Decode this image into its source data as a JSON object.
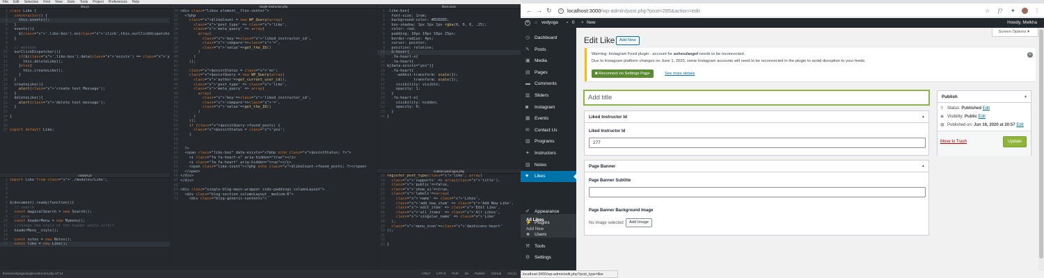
{
  "editor": {
    "menu": [
      "File",
      "Edit",
      "Selection",
      "Find",
      "View",
      "Goto",
      "Tools",
      "Project",
      "Preferences",
      "Help"
    ],
    "panes": {
      "likejs": {
        "title": "like.js",
        "lines": [
          "class Like {",
          "  constructor() {",
          "    this.events();",
          "  }",
          "  events(){",
          "    $('.like-box').on('click',this.ourClickDispatcher.bind(this));",
          "  }",
          "",
          "  // methods",
          "  ourClickDispatcher(){",
          "    if($('.like-box').data('exists') == 'yes'){",
          "      this.deleteLike();",
          "    }else{",
          "      this.createLike();",
          "    }",
          "  }",
          "  createLike(){",
          "    alert('create test Message');",
          "  }",
          "  deleteLike(){",
          "    alert('delete test message');",
          "  }",
          "",
          "}",
          "",
          "",
          "export default Like;"
        ]
      },
      "customjs": {
        "title": "custom.js",
        "lines": [
          "import Like from './modules/Like';",
          "",
          "",
          "",
          "",
          "$(document).ready(function(){",
          "  // search",
          "  const magicalSearch = new Search();",
          "  // menu",
          "  const headerMenu = new Mymenu();",
          "  //change the style of the header while scroll",
          "  headerMenu__style();",
          "",
          "  const notes = new Notes();",
          "  const like = new Like();"
        ]
      },
      "php": {
        "title": "single-instructor.php",
        "start": 30,
        "lines": [
          "<div class=\"likes element__flex-center\">",
          "  <?php",
          "    $likeCount = new WP_Query(array(",
          "      'post_type' => 'like',",
          "      'meta_query' => array(",
          "        array(",
          "          'key'=>'liked_instructor_id',",
          "          'compare'=>'=',",
          "          'value'=>get_the_ID()",
          "        )",
          "      )",
          "    ));",
          "",
          "    $existStatus = 'no';",
          "    $existQuery = new WP_Query(array(",
          "      'author'=>get_current_user_id(),",
          "      'post_type' => 'like',",
          "      'meta_query' => array(",
          "        array(",
          "          'key'=>'liked_instructor_id',",
          "          'compare'=>'=',",
          "          'value'=>get_the_ID()",
          "        )",
          "      )",
          "    ));",
          "    if ($existQuery->found_posts) {",
          "      $existStatus = 'yes';",
          "    }",
          "",
          "",
          "  ?>",
          "  <span class=\"like-box\" data-exists=\"<?php echo $existStatus; ?>\">",
          "    <i class=\"fa fa-heart-o\" aria-hidden=\"true\"></i>",
          "    <i class=\"fa fa-heart\" aria-hidden=\"true\"></i>",
          "    <span class=\"like-count\"><?php echo $likeCount->found_posts; ?></span>",
          "  </span>",
          "</div>",
          "</div>",
          "",
          "<div class=\"single-blog-main-wrapper side-paddings columnLayout\">",
          "  <div class=\"blog-section columnLayout__medium-8\">",
          "    <div class=\"blog-generic-contents\">"
        ]
      },
      "scss": {
        "title": "likes.scss",
        "start": 1,
        "lines": [
          ".like-box{",
          "  font-size: 1rem;",
          "  background-color: #EDEDED;",
          "  box-shadow: 1px 1px 1px rgba(0, 0, 0, .25);",
          "  color: red;",
          "  padding: 10px 10px 10px 25px;",
          "  border-radius: 4px;",
          "  cursor: pointer;",
          "  position: relative;",
          "  &:hover{",
          "  .fa-heart-o{",
          "  .fa-heart{",
          "&[data-exists=\"yes\"]{",
          "  .fa-heart{",
          "    -webkit-transform: scale(1);",
          "            transform: scale(1);",
          "    visibility: visible;",
          "    opacity: 1;",
          "  }",
          "  .fa-heart-o{",
          "    visibility: hidden;",
          "    opacity: 0;",
          "  }",
          "}"
        ]
      },
      "cpt": {
        "title": "custom-post-type.php",
        "start": 18,
        "lines": [
          "register_post_type('like', array(",
          "  'supports' => array('title'),",
          "  'public'=>false,",
          "  'show_ui'=>true,",
          "  'labels'=>array(",
          "    'name' => 'Likes',",
          "    'add_new_item' => 'Add New Like',",
          "    'edit_item' => 'Edit Like',",
          "    'all_items' => 'All Likes',",
          "    'singular_name' => 'Like'",
          "  ),",
          "  'menu_icon'=>'dashicons-heart'",
          "));",
          "",
          "",
          "}"
        ]
      }
    },
    "status_left": "theme/vedyoga/single-instructor.php   47:14",
    "status_right": [
      "CRLF",
      "UTF-8",
      "PHP",
      "29",
      "Publish",
      "GitHub",
      "Git (1)"
    ]
  },
  "browser": {
    "url_host": "localhost:3000",
    "url_path": "/wp-admin/post.php?post=285&action=edit",
    "status_url": "localhost:3000/wp-admin/edit.php?post_type=like"
  },
  "wp": {
    "site_name": "vedyoga",
    "comment_count": "0",
    "new_label": "New",
    "howdy": "Howdy, Metkha",
    "screen_options": "Screen Options",
    "menu": [
      {
        "label": "Dashboard",
        "icon": "dashboard"
      },
      {
        "label": "Posts",
        "icon": "pin"
      },
      {
        "label": "Media",
        "icon": "media"
      },
      {
        "label": "Pages",
        "icon": "page"
      },
      {
        "label": "Comments",
        "icon": "comment"
      },
      {
        "label": "Sliders",
        "icon": "slider"
      },
      {
        "label": "Instagram",
        "icon": "instagram"
      },
      {
        "label": "Events",
        "icon": "calendar"
      },
      {
        "label": "Contact Us",
        "icon": "contact"
      },
      {
        "label": "Programs",
        "icon": "program"
      },
      {
        "label": "Instructors",
        "icon": "instructor"
      },
      {
        "label": "Notes",
        "icon": "note"
      },
      {
        "label": "Likes",
        "icon": "heart"
      },
      {
        "label": "Appearance",
        "icon": "brush"
      },
      {
        "label": "Plugins",
        "icon": "plugin"
      },
      {
        "label": "Users",
        "icon": "user"
      },
      {
        "label": "Tools",
        "icon": "wrench"
      },
      {
        "label": "Settings",
        "icon": "settings"
      }
    ],
    "submenu": [
      "All Likes",
      "Add New"
    ],
    "page_title": "Edit Like",
    "add_new": "Add New",
    "notice": {
      "line1_prefix": "Warning: Instagram Feed plugin - account for ",
      "account": "ashesdangol",
      "line1_suffix": " needs to be reconnected.",
      "line2": "Due to Instagram platform changes on June 1, 2020, some Instagram accounts will need to be reconnected in the plugin to avoid disruption to your feeds.",
      "button": "Reconnect on Settings Page",
      "link": "See more details"
    },
    "title_placeholder": "Add title",
    "liked": {
      "header": "Liked Instructor Id",
      "label": "Liked Instructor Id",
      "value": "277"
    },
    "banner": {
      "header": "Page Banner",
      "subtitle_label": "Page Banner Subtitle",
      "bg_label": "Page Banner Background Image",
      "no_image": "No image selected",
      "add_image": "Add Image"
    },
    "publish": {
      "header": "Publish",
      "status_label": "Status: ",
      "status_value": "Published",
      "edit": "Edit",
      "visibility_label": "Visibility: ",
      "visibility_value": "Public",
      "published_label": "Published on: ",
      "published_value": "Jun 16, 2020 at 20:57",
      "trash": "Move to Trash",
      "update": "Update"
    }
  }
}
